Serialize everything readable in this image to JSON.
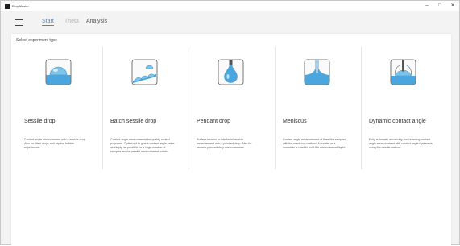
{
  "window": {
    "title": "DropMaster"
  },
  "window_controls": {
    "minimize": "–",
    "maximize": "□",
    "close": "✕"
  },
  "tabs": [
    {
      "label": "Start",
      "active": true
    },
    {
      "label": "Theta",
      "active": false
    },
    {
      "label": "Analysis",
      "active": false
    }
  ],
  "section_title": "Select experiment type",
  "colors": {
    "accent": "#3b8fd9",
    "icon_blue": "#4aa6df"
  },
  "cards": [
    {
      "title": "Sessile drop",
      "icon": "sessile-drop-icon",
      "description": "Contact angle measurement with a sessile drop. Also for tilted drops and captive bubble experiments."
    },
    {
      "title": "Batch sessile drop",
      "icon": "batch-sessile-drop-icon",
      "description": "Contact angle measurement for quality control purposes. Optimized to give a contact angle value as simply as possible for a large number of samples and/or parallel measurement points."
    },
    {
      "title": "Pendant drop",
      "icon": "pendant-drop-icon",
      "description": "Surface tension or interfacial tension measurement with a pendant drop. Also for reverse pendant drop measurements."
    },
    {
      "title": "Meniscus",
      "icon": "meniscus-icon",
      "description": "Contact angle measurement of fiber-like samples with the meniscus method. A cuvette or a container is used to hold the measurement liquid."
    },
    {
      "title": "Dynamic contact angle",
      "icon": "dynamic-contact-angle-icon",
      "description": "Fully automatic advancing and receding contact angle measurement with contact angle hysteresis using the needle method."
    }
  ]
}
